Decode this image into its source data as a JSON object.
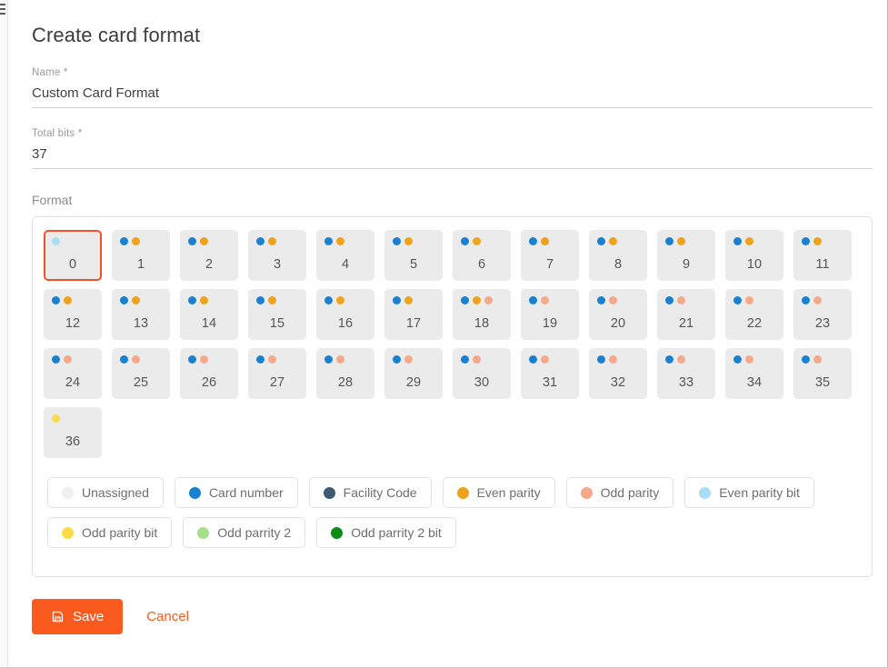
{
  "dialog": {
    "title": "Create card format"
  },
  "fields": {
    "name": {
      "label": "Name *",
      "value": "Custom Card Format",
      "placeholder": "Name"
    },
    "total_bits": {
      "label": "Total bits *",
      "value": "37",
      "placeholder": "Total bits"
    }
  },
  "format": {
    "label": "Format",
    "selected_index": 0,
    "selection_color": "#f0512a",
    "bits": [
      {
        "num": "0",
        "dots": [
          "even-parity-bit"
        ]
      },
      {
        "num": "1",
        "dots": [
          "card-number",
          "even-parity"
        ]
      },
      {
        "num": "2",
        "dots": [
          "card-number",
          "even-parity"
        ]
      },
      {
        "num": "3",
        "dots": [
          "card-number",
          "even-parity"
        ]
      },
      {
        "num": "4",
        "dots": [
          "card-number",
          "even-parity"
        ]
      },
      {
        "num": "5",
        "dots": [
          "card-number",
          "even-parity"
        ]
      },
      {
        "num": "6",
        "dots": [
          "card-number",
          "even-parity"
        ]
      },
      {
        "num": "7",
        "dots": [
          "card-number",
          "even-parity"
        ]
      },
      {
        "num": "8",
        "dots": [
          "card-number",
          "even-parity"
        ]
      },
      {
        "num": "9",
        "dots": [
          "card-number",
          "even-parity"
        ]
      },
      {
        "num": "10",
        "dots": [
          "card-number",
          "even-parity"
        ]
      },
      {
        "num": "11",
        "dots": [
          "card-number",
          "even-parity"
        ]
      },
      {
        "num": "12",
        "dots": [
          "card-number",
          "even-parity"
        ]
      },
      {
        "num": "13",
        "dots": [
          "card-number",
          "even-parity"
        ]
      },
      {
        "num": "14",
        "dots": [
          "card-number",
          "even-parity"
        ]
      },
      {
        "num": "15",
        "dots": [
          "card-number",
          "even-parity"
        ]
      },
      {
        "num": "16",
        "dots": [
          "card-number",
          "even-parity"
        ]
      },
      {
        "num": "17",
        "dots": [
          "card-number",
          "even-parity"
        ]
      },
      {
        "num": "18",
        "dots": [
          "card-number",
          "even-parity",
          "odd-parity"
        ]
      },
      {
        "num": "19",
        "dots": [
          "card-number",
          "odd-parity"
        ]
      },
      {
        "num": "20",
        "dots": [
          "card-number",
          "odd-parity"
        ]
      },
      {
        "num": "21",
        "dots": [
          "card-number",
          "odd-parity"
        ]
      },
      {
        "num": "22",
        "dots": [
          "card-number",
          "odd-parity"
        ]
      },
      {
        "num": "23",
        "dots": [
          "card-number",
          "odd-parity"
        ]
      },
      {
        "num": "24",
        "dots": [
          "card-number",
          "odd-parity"
        ]
      },
      {
        "num": "25",
        "dots": [
          "card-number",
          "odd-parity"
        ]
      },
      {
        "num": "26",
        "dots": [
          "card-number",
          "odd-parity"
        ]
      },
      {
        "num": "27",
        "dots": [
          "card-number",
          "odd-parity"
        ]
      },
      {
        "num": "28",
        "dots": [
          "card-number",
          "odd-parity"
        ]
      },
      {
        "num": "29",
        "dots": [
          "card-number",
          "odd-parity"
        ]
      },
      {
        "num": "30",
        "dots": [
          "card-number",
          "odd-parity"
        ]
      },
      {
        "num": "31",
        "dots": [
          "card-number",
          "odd-parity"
        ]
      },
      {
        "num": "32",
        "dots": [
          "card-number",
          "odd-parity"
        ]
      },
      {
        "num": "33",
        "dots": [
          "card-number",
          "odd-parity"
        ]
      },
      {
        "num": "34",
        "dots": [
          "card-number",
          "odd-parity"
        ]
      },
      {
        "num": "35",
        "dots": [
          "card-number",
          "odd-parity"
        ]
      },
      {
        "num": "36",
        "dots": [
          "odd-parity-bit"
        ]
      }
    ]
  },
  "legend": [
    {
      "key": "unassigned",
      "label": "Unassigned",
      "color": "#f0f0f0"
    },
    {
      "key": "card-number",
      "label": "Card number",
      "color": "#1a80d0"
    },
    {
      "key": "facility-code",
      "label": "Facility Code",
      "color": "#3d5a73"
    },
    {
      "key": "even-parity",
      "label": "Even parity",
      "color": "#efa31d"
    },
    {
      "key": "odd-parity",
      "label": "Odd parity",
      "color": "#f5a98a"
    },
    {
      "key": "even-parity-bit",
      "label": "Even parity bit",
      "color": "#a9dcf5"
    },
    {
      "key": "odd-parity-bit",
      "label": "Odd parity bit",
      "color": "#fada4a"
    },
    {
      "key": "odd-parrity-2",
      "label": "Odd parrity 2",
      "color": "#a4e08a"
    },
    {
      "key": "odd-parrity-2-bit",
      "label": "Odd parrity 2 bit",
      "color": "#0e8a16"
    }
  ],
  "actions": {
    "save_label": "Save",
    "save_icon": "save-icon",
    "cancel_label": "Cancel",
    "accent_color": "#fa5a1e"
  }
}
